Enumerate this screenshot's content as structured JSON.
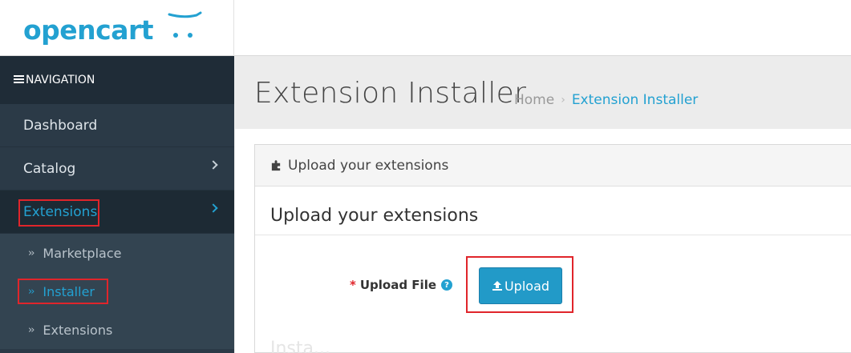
{
  "logo": {
    "text": "opencart"
  },
  "nav": {
    "header": "NAVIGATION",
    "items": [
      {
        "label": "Dashboard"
      },
      {
        "label": "Catalog"
      },
      {
        "label": "Extensions"
      }
    ],
    "sub_items": [
      {
        "label": "Marketplace"
      },
      {
        "label": "Installer"
      },
      {
        "label": "Extensions"
      }
    ]
  },
  "page": {
    "title": "Extension Installer",
    "breadcrumb": [
      "Home",
      "Extension Installer"
    ]
  },
  "panel": {
    "heading": "Upload your extensions",
    "legend": "Upload your extensions",
    "upload_label": "Upload File",
    "required_mark": "*",
    "upload_button": "Upload",
    "faded": "Insta..."
  },
  "colors": {
    "accent": "#23a1d1",
    "highlight": "#e0252b",
    "sidebar": "#2b3a47"
  }
}
